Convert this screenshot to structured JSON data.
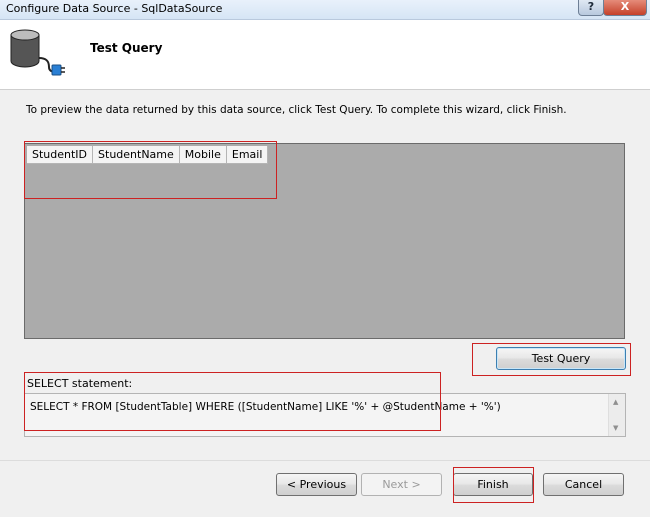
{
  "window": {
    "title": "Configure Data Source - SqlDataSource",
    "help_glyph": "?",
    "close_glyph": "X",
    "accent_color": "#cc2222"
  },
  "header": {
    "title": "Test Query",
    "icon": "database-plug-icon"
  },
  "instructions": "To preview the data returned by this data source, click Test Query. To complete this wizard, click Finish.",
  "grid": {
    "columns": [
      "StudentID",
      "StudentName",
      "Mobile",
      "Email"
    ]
  },
  "buttons": {
    "test_query": "Test Query",
    "previous": "< Previous",
    "next": "Next >",
    "finish": "Finish",
    "cancel": "Cancel"
  },
  "select_statement": {
    "label": "SELECT statement:",
    "value": "SELECT * FROM [StudentTable] WHERE ([StudentName] LIKE '%' + @StudentName + '%')"
  }
}
